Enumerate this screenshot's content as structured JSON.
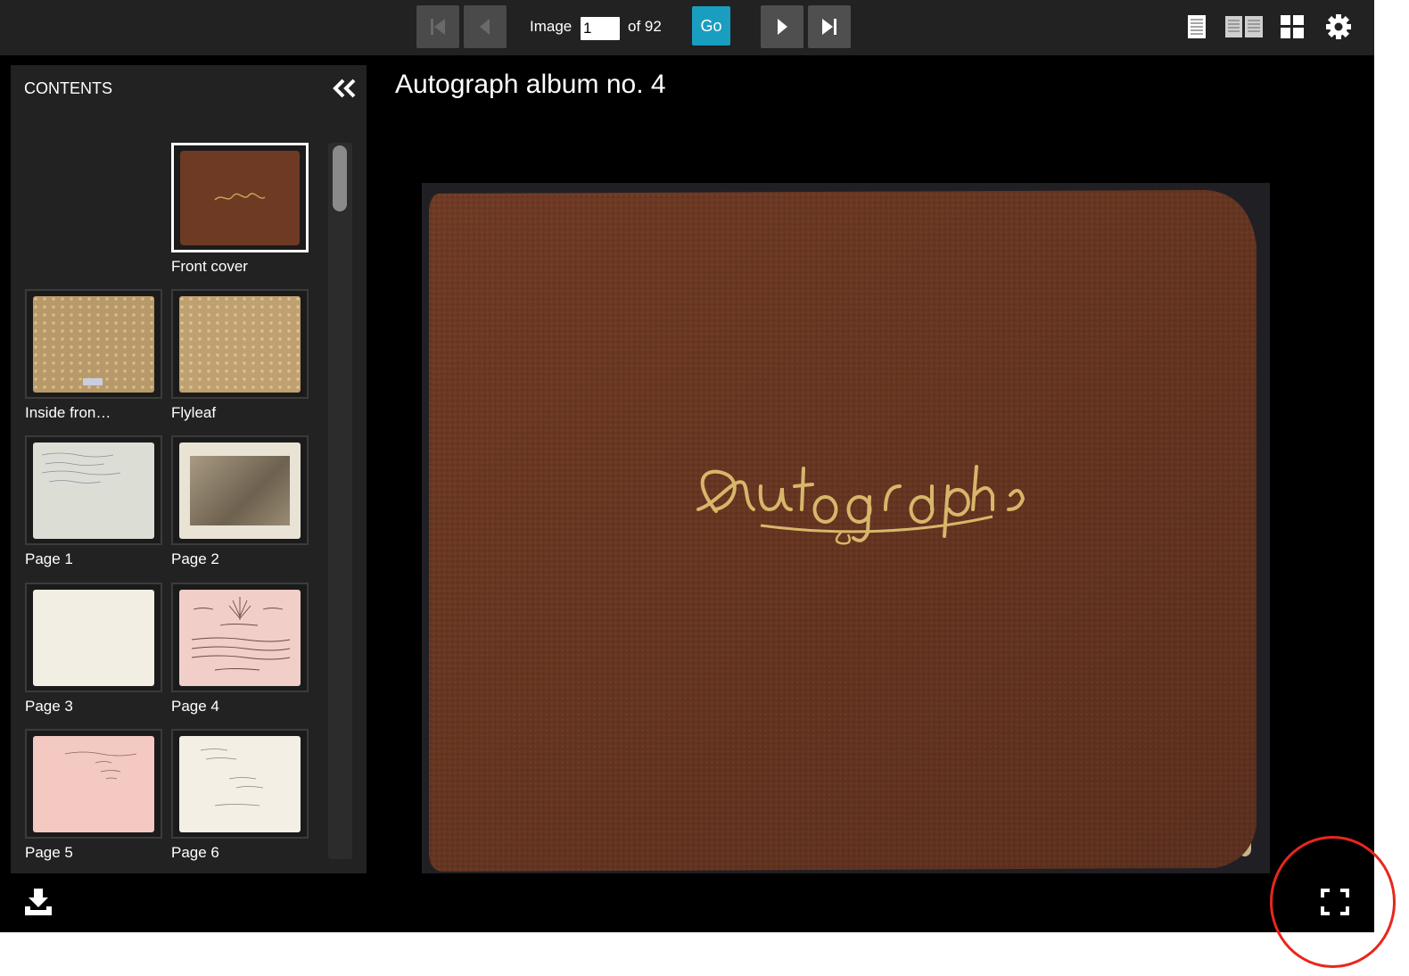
{
  "toolbar": {
    "image_label": "Image",
    "image_value": "1",
    "of_label": "of 92",
    "go_label": "Go"
  },
  "sidebar": {
    "title": "CONTENTS",
    "thumbnails": [
      {
        "label": "Front cover"
      },
      {
        "label": "Inside fron…"
      },
      {
        "label": "Flyleaf"
      },
      {
        "label": "Page 1"
      },
      {
        "label": "Page 2"
      },
      {
        "label": "Page 3"
      },
      {
        "label": "Page 4"
      },
      {
        "label": "Page 5"
      },
      {
        "label": "Page 6"
      }
    ]
  },
  "main": {
    "title": "Autograph album no. 4",
    "cover_text": "Autographs"
  },
  "icons": [
    "first-page-icon",
    "previous-page-icon",
    "next-page-icon",
    "last-page-icon",
    "single-page-view-icon",
    "two-page-view-icon",
    "grid-view-icon",
    "settings-gear-icon",
    "collapse-sidebar-icon",
    "download-icon",
    "fullscreen-icon"
  ],
  "colors": {
    "accent": "#1a9ec0",
    "highlight": "#e8271c",
    "cover": "#6e3a24"
  }
}
